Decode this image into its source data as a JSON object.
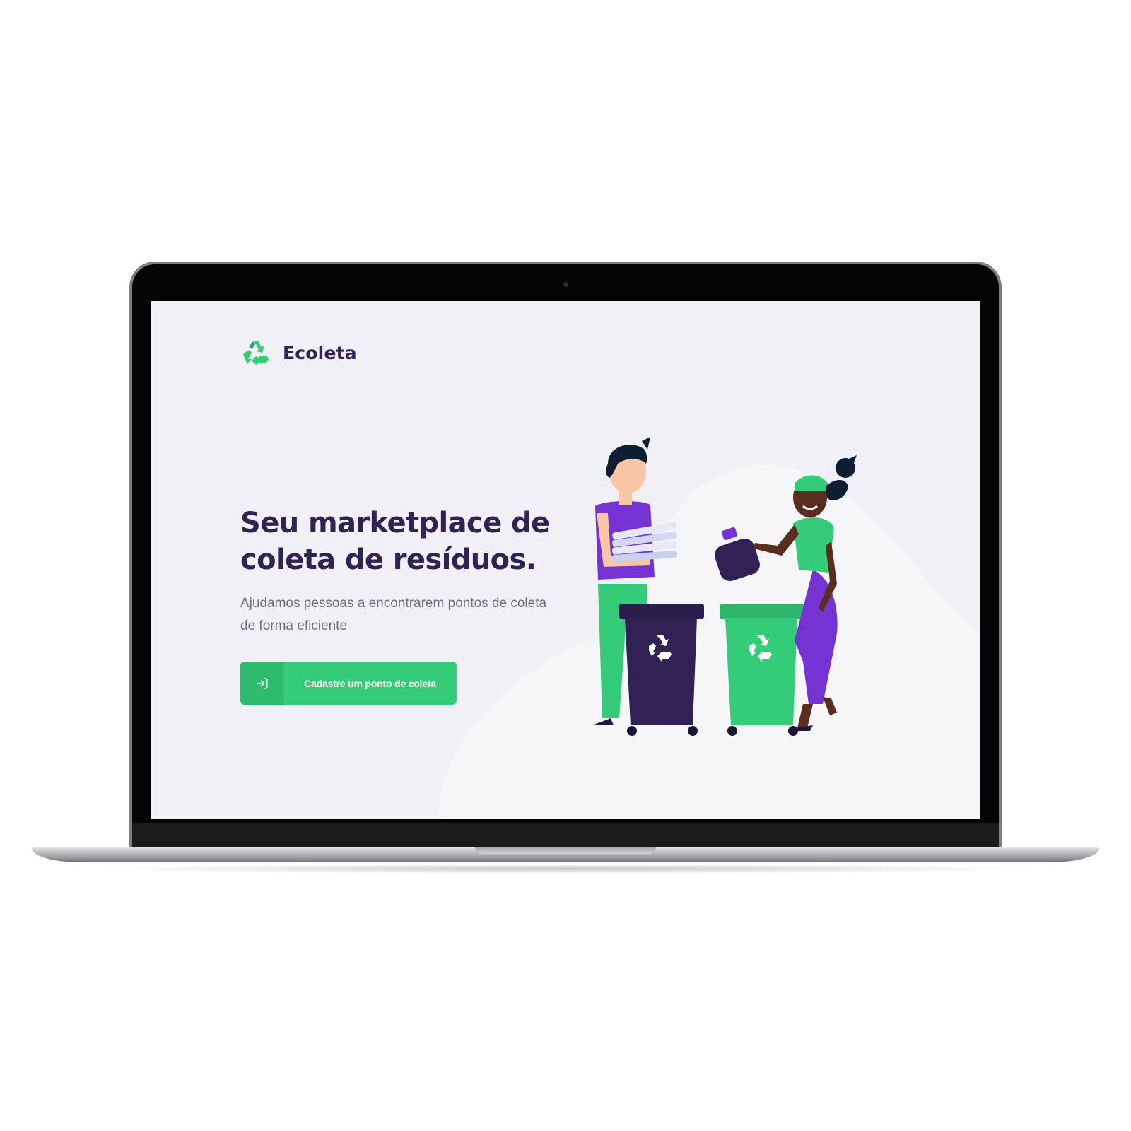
{
  "brand": {
    "name": "Ecoleta",
    "logo_icon": "recycle-icon",
    "accent": "#34cb79",
    "title_color": "#322153"
  },
  "hero": {
    "title_line1": "Seu marketplace de",
    "title_line2": "coleta de resíduos.",
    "subtitle_line1": "Ajudamos pessoas a encontrarem pontos de coleta",
    "subtitle_line2": "de forma eficiente"
  },
  "cta": {
    "label": "Cadastre um ponto de coleta",
    "icon": "log-in-icon"
  },
  "illustration": {
    "subject": "recycling-people-illustration"
  }
}
